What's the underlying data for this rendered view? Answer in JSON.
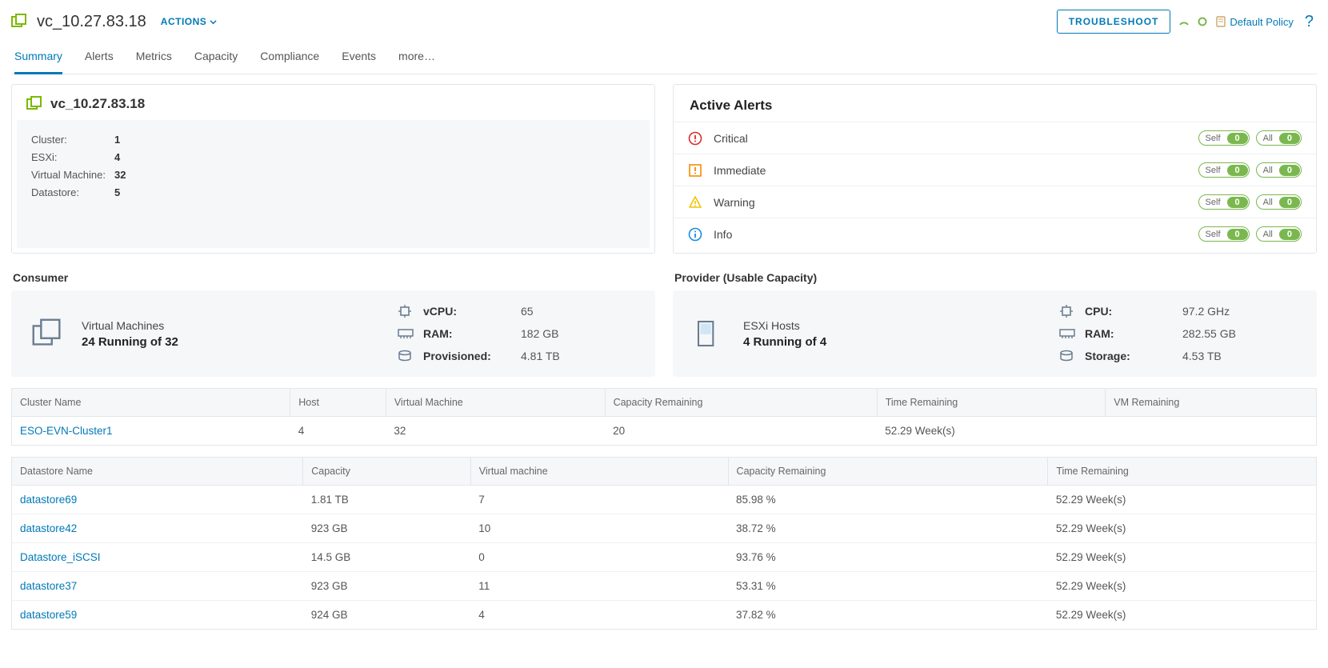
{
  "header": {
    "title": "vc_10.27.83.18",
    "actions": "ACTIONS",
    "troubleshoot": "TROUBLESHOOT",
    "policy": "Default Policy"
  },
  "tabs": [
    "Summary",
    "Alerts",
    "Metrics",
    "Capacity",
    "Compliance",
    "Events",
    "more…"
  ],
  "active_tab": 0,
  "summary_card": {
    "title": "vc_10.27.83.18",
    "rows": [
      {
        "label": "Cluster:",
        "value": "1"
      },
      {
        "label": "ESXi:",
        "value": "4"
      },
      {
        "label": "Virtual Machine:",
        "value": "32"
      },
      {
        "label": "Datastore:",
        "value": "5"
      }
    ]
  },
  "alerts_card": {
    "title": "Active Alerts",
    "self_label": "Self",
    "all_label": "All",
    "levels": [
      {
        "name": "Critical",
        "self": 0,
        "all": 0,
        "color": "#e02a2a",
        "kind": "critical"
      },
      {
        "name": "Immediate",
        "self": 0,
        "all": 0,
        "color": "#f58b00",
        "kind": "immediate"
      },
      {
        "name": "Warning",
        "self": 0,
        "all": 0,
        "color": "#f3c200",
        "kind": "warning"
      },
      {
        "name": "Info",
        "self": 0,
        "all": 0,
        "color": "#178be0",
        "kind": "info"
      }
    ]
  },
  "consumer": {
    "heading": "Consumer",
    "title": "Virtual Machines",
    "subtitle": "24 Running of 32",
    "metrics": [
      {
        "icon": "cpu",
        "label": "vCPU:",
        "value": "65"
      },
      {
        "icon": "ram",
        "label": "RAM:",
        "value": "182 GB"
      },
      {
        "icon": "disk",
        "label": "Provisioned:",
        "value": "4.81 TB"
      }
    ]
  },
  "provider": {
    "heading": "Provider (Usable Capacity)",
    "title": "ESXi Hosts",
    "subtitle": "4 Running of 4",
    "metrics": [
      {
        "icon": "cpu",
        "label": "CPU:",
        "value": "97.2 GHz"
      },
      {
        "icon": "ram",
        "label": "RAM:",
        "value": "282.55 GB"
      },
      {
        "icon": "disk",
        "label": "Storage:",
        "value": "4.53 TB"
      }
    ]
  },
  "cluster_table": {
    "headers": [
      "Cluster Name",
      "Host",
      "Virtual Machine",
      "Capacity Remaining",
      "Time Remaining",
      "VM Remaining"
    ],
    "rows": [
      {
        "name": "ESO-EVN-Cluster1",
        "host": "4",
        "vm": "32",
        "cap": "20",
        "time": "52.29 Week(s)",
        "vmr": ""
      }
    ]
  },
  "ds_table": {
    "headers": [
      "Datastore Name",
      "Capacity",
      "Virtual machine",
      "Capacity Remaining",
      "Time Remaining"
    ],
    "rows": [
      {
        "name": "datastore69",
        "cap": "1.81 TB",
        "vm": "7",
        "cr": "85.98 %",
        "tr": "52.29 Week(s)"
      },
      {
        "name": "datastore42",
        "cap": "923 GB",
        "vm": "10",
        "cr": "38.72 %",
        "tr": "52.29 Week(s)"
      },
      {
        "name": "Datastore_iSCSI",
        "cap": "14.5 GB",
        "vm": "0",
        "cr": "93.76 %",
        "tr": "52.29 Week(s)"
      },
      {
        "name": "datastore37",
        "cap": "923 GB",
        "vm": "11",
        "cr": "53.31 %",
        "tr": "52.29 Week(s)"
      },
      {
        "name": "datastore59",
        "cap": "924 GB",
        "vm": "4",
        "cr": "37.82 %",
        "tr": "52.29 Week(s)"
      }
    ]
  }
}
